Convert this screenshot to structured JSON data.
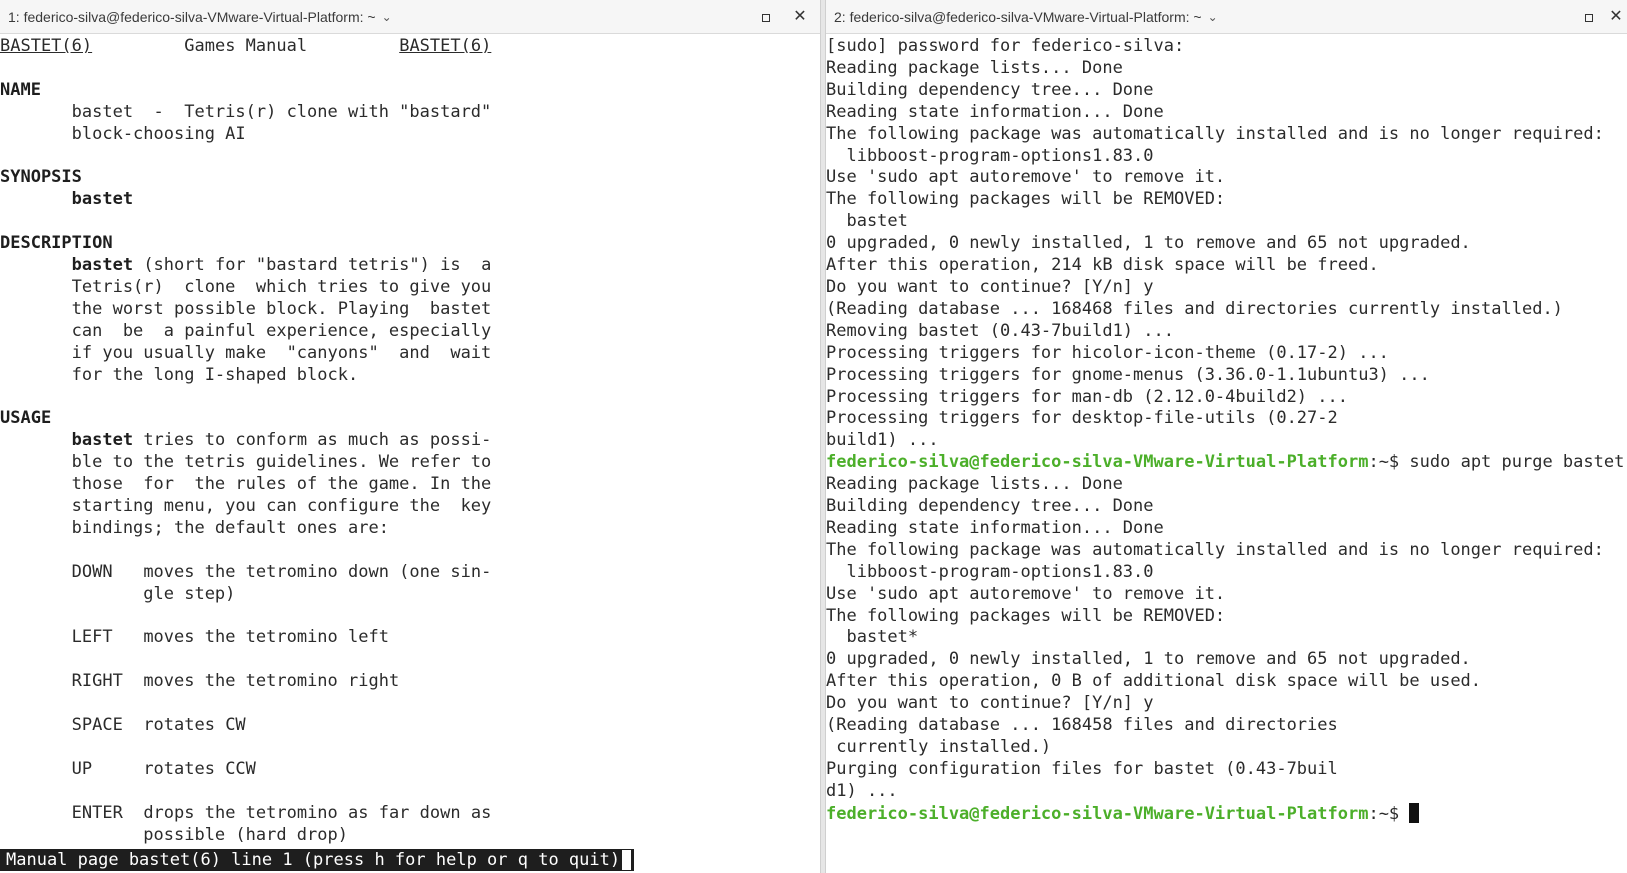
{
  "left_pane": {
    "title": "1: federico-silva@federico-silva-VMware-Virtual-Platform: ~",
    "status": "Manual page bastet(6) line 1 (press h for help or q to quit)",
    "header": {
      "left": "BASTET(6)",
      "center": "Games Manual",
      "right": "BASTET(6)"
    },
    "sections": {
      "name_heading": "NAME",
      "name_lines": [
        "bastet  -  Tetris(r) clone with \"bastard\"",
        "block-choosing AI"
      ],
      "synopsis_heading": "SYNOPSIS",
      "synopsis_cmd": "bastet",
      "description_heading": "DESCRIPTION",
      "description_cmd": "bastet",
      "description_first": " (short for \"bastard tetris\") is  a",
      "description_lines": [
        "Tetris(r)  clone  which tries to give you",
        "the worst possible block. Playing  bastet",
        "can  be  a painful experience, especially",
        "if you usually make  \"canyons\"  and  wait",
        "for the long I-shaped block."
      ],
      "usage_heading": "USAGE",
      "usage_cmd": "bastet",
      "usage_first": " tries to conform as much as possi-",
      "usage_lines": [
        "ble to the tetris guidelines. We refer to",
        "those  for  the rules of the game. In the",
        "starting menu, you can configure the  key",
        "bindings; the default ones are:"
      ],
      "keys": [
        {
          "key": "DOWN",
          "desc": [
            "moves the tetromino down (one sin-",
            "gle step)"
          ]
        },
        {
          "key": "LEFT",
          "desc": [
            "moves the tetromino left"
          ]
        },
        {
          "key": "RIGHT",
          "desc": [
            "moves the tetromino right"
          ]
        },
        {
          "key": "SPACE",
          "desc": [
            "rotates CW"
          ]
        },
        {
          "key": "UP",
          "desc": [
            "rotates CCW"
          ]
        },
        {
          "key": "ENTER",
          "desc": [
            "drops the tetromino as far down as",
            "possible (hard drop)"
          ]
        }
      ]
    }
  },
  "right_pane": {
    "title": "2: federico-silva@federico-silva-VMware-Virtual-Platform: ~",
    "prompt_user": "federico-silva@federico-silva-VMware-Virtual-Platform",
    "prompt_suffix": ":~$ ",
    "command": "sudo apt purge bastet",
    "output_before": [
      "[sudo] password for federico-silva:",
      "Reading package lists... Done",
      "Building dependency tree... Done",
      "Reading state information... Done",
      "The following package was automatically installed and is no longer required:",
      "  libboost-program-options1.83.0",
      "Use 'sudo apt autoremove' to remove it.",
      "The following packages will be REMOVED:",
      "  bastet",
      "0 upgraded, 0 newly installed, 1 to remove and 65 not upgraded.",
      "After this operation, 214 kB disk space will be freed.",
      "Do you want to continue? [Y/n] y",
      "(Reading database ... 168468 files and directories currently installed.)",
      "Removing bastet (0.43-7build1) ...",
      "Processing triggers for hicolor-icon-theme (0.17-2) ...",
      "Processing triggers for gnome-menus (3.36.0-1.1ubuntu3) ...",
      "Processing triggers for man-db (2.12.0-4build2) ...",
      "Processing triggers for desktop-file-utils (0.27-2",
      "build1) ..."
    ],
    "output_after": [
      "Reading package lists... Done",
      "Building dependency tree... Done",
      "Reading state information... Done",
      "The following package was automatically installed and is no longer required:",
      "  libboost-program-options1.83.0",
      "Use 'sudo apt autoremove' to remove it.",
      "The following packages will be REMOVED:",
      "  bastet*",
      "0 upgraded, 0 newly installed, 1 to remove and 65 not upgraded.",
      "After this operation, 0 B of additional disk space will be used.",
      "Do you want to continue? [Y/n] y",
      "(Reading database ... 168458 files and directories",
      " currently installed.)",
      "Purging configuration files for bastet (0.43-7buil",
      "d1) ..."
    ]
  },
  "icons": {
    "chevron": "chevron-down-icon",
    "maximize": "maximize-icon",
    "close": "close-icon"
  }
}
